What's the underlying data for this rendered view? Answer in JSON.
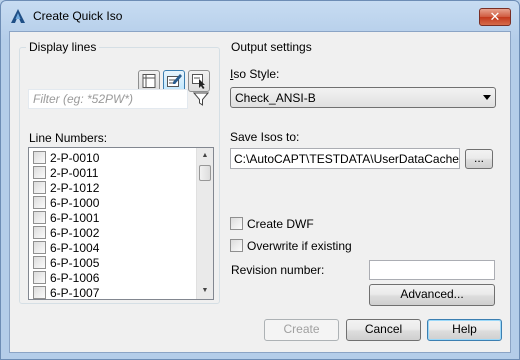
{
  "window": {
    "title": "Create Quick Iso",
    "close_glyph": "✕",
    "icon": "autocad-a-icon"
  },
  "display_lines": {
    "group_title": "Display lines",
    "tool_buttons": [
      {
        "name": "list-view-icon"
      },
      {
        "name": "edit-selection-icon",
        "active": true
      },
      {
        "name": "select-from-drawing-icon"
      }
    ],
    "filter_placeholder": "Filter (eg: *52PW*)",
    "filter_icon": "funnel-icon",
    "line_numbers_label": "Line Numbers:",
    "line_numbers": [
      "2-P-0010",
      "2-P-0011",
      "2-P-1012",
      "6-P-1000",
      "6-P-1001",
      "6-P-1002",
      "6-P-1004",
      "6-P-1005",
      "6-P-1006",
      "6-P-1007"
    ]
  },
  "output_settings": {
    "group_title": "Output settings",
    "iso_style_label": "Iso Style:",
    "iso_style_value": "Check_ANSI-B",
    "save_isos_label": "Save Isos to:",
    "save_path": "C:\\AutoCAPT\\TESTDATA\\UserDataCache\\Sa",
    "browse_label": "...",
    "create_dwf_label": "Create DWF",
    "overwrite_label": "Overwrite if existing",
    "revision_label": "Revision number:",
    "revision_value": "",
    "advanced_label": "Advanced..."
  },
  "footer": {
    "create_label": "Create",
    "cancel_label": "Cancel",
    "help_label": "Help"
  },
  "colors": {
    "accent": "#3c7fb1",
    "close_red": "#c3391c"
  }
}
